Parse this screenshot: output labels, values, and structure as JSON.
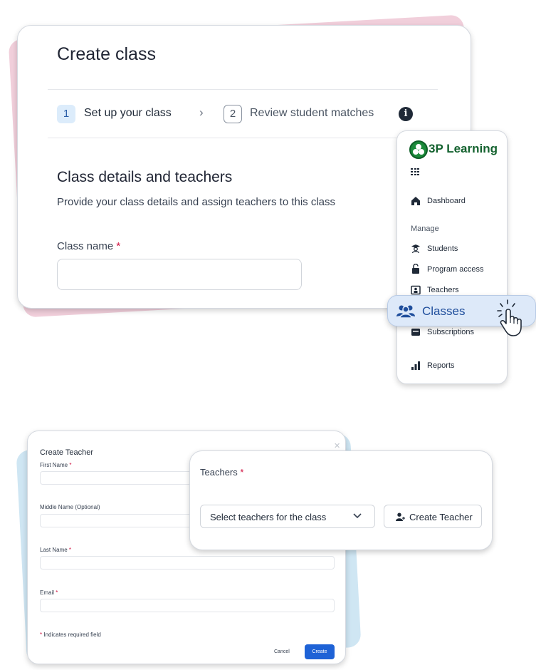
{
  "create_class": {
    "title": "Create class",
    "steps": [
      {
        "number": "1",
        "label": "Set up your class"
      },
      {
        "number": "2",
        "label": "Review student matches"
      }
    ],
    "section_title": "Class details and teachers",
    "section_description": "Provide your class details and assign teachers to this class",
    "class_name_label": "Class name",
    "required_marker": "*",
    "class_name_value": ""
  },
  "nav": {
    "brand": "3P Learning",
    "items": [
      {
        "label": "Dashboard",
        "icon": "home-icon"
      },
      {
        "label": "Students",
        "icon": "graduate-icon"
      },
      {
        "label": "Program access",
        "icon": "lock-icon"
      },
      {
        "label": "Teachers",
        "icon": "presentation-icon"
      },
      {
        "label": "Classes",
        "icon": "users-icon"
      },
      {
        "label": "Subscriptions",
        "icon": "wallet-icon"
      },
      {
        "label": "Reports",
        "icon": "bar-chart-icon"
      }
    ],
    "section_manage": "Manage",
    "active_item": "Classes",
    "accent_color": "#1f4e9c",
    "brand_color": "#1b8a3a"
  },
  "create_teacher": {
    "title": "Create Teacher",
    "fields": [
      {
        "label": "First Name",
        "required": "*"
      },
      {
        "label": "Middle Name (Optional)",
        "required": ""
      },
      {
        "label": "Last Name",
        "required": "*"
      },
      {
        "label": "Email",
        "required": "*"
      }
    ],
    "required_note": "Indicates required field",
    "required_marker": "*",
    "cancel_label": "Cancel",
    "create_label": "Create",
    "primary_color": "#1e62d6"
  },
  "teachers_select": {
    "label": "Teachers",
    "required_marker": "*",
    "placeholder": "Select teachers for the class",
    "create_button_label": "Create Teacher"
  }
}
